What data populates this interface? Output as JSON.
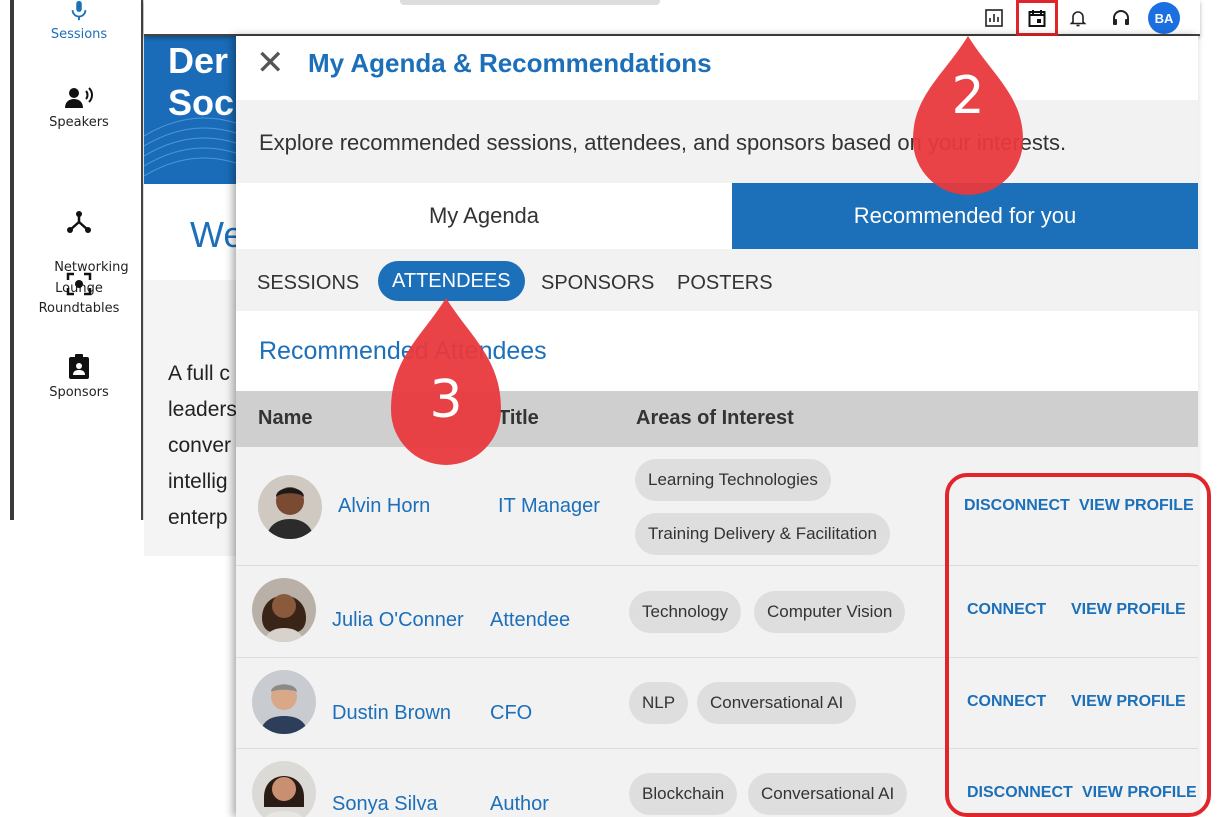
{
  "sidebar": {
    "items": [
      {
        "label": "Sessions",
        "icon": "microphone-icon",
        "active": true
      },
      {
        "label": "Speakers",
        "icon": "speaker-icon"
      },
      {
        "label": "Networking\nLounge",
        "icon": "network-icon"
      },
      {
        "label": "Roundtables",
        "icon": "roundtable-icon"
      },
      {
        "label": "Sponsors",
        "icon": "badge-icon"
      }
    ]
  },
  "topbar": {
    "icons": [
      "chart-icon",
      "calendar-icon",
      "bell-icon",
      "headset-icon"
    ],
    "avatar_initials": "BA"
  },
  "background_page": {
    "hero_title": "Der\nSoc",
    "welcome": "We",
    "paragraph": "A full c\nleaders\nconver\nintellig\nenterp"
  },
  "panel": {
    "title": "My Agenda & Recommendations",
    "description": "Explore recommended sessions, attendees, and sponsors based on your interests.",
    "tabs": {
      "my_agenda": "My Agenda",
      "recommended": "Recommended for you"
    },
    "subtabs": {
      "sessions": "SESSIONS",
      "attendees": "ATTENDEES",
      "sponsors": "SPONSORS",
      "posters": "POSTERS"
    },
    "section_title": "Recommended Attendees",
    "columns": {
      "name": "Name",
      "title": "Title",
      "interests": "Areas of Interest"
    },
    "rows": [
      {
        "name": "Alvin Horn",
        "title": "IT Manager",
        "interests": [
          "Learning Technologies",
          "Training Delivery & Facilitation"
        ],
        "primary_action": "DISCONNECT",
        "secondary_action": "VIEW PROFILE"
      },
      {
        "name": "Julia O'Conner",
        "title": "Attendee",
        "interests": [
          "Technology",
          "Computer Vision"
        ],
        "primary_action": "CONNECT",
        "secondary_action": "VIEW PROFILE"
      },
      {
        "name": "Dustin Brown",
        "title": "CFO",
        "interests": [
          "NLP",
          "Conversational AI"
        ],
        "primary_action": "CONNECT",
        "secondary_action": "VIEW PROFILE"
      },
      {
        "name": "Sonya Silva",
        "title": "Author",
        "interests": [
          "Blockchain",
          "Conversational AI"
        ],
        "primary_action": "DISCONNECT",
        "secondary_action": "VIEW PROFILE"
      }
    ]
  },
  "callouts": {
    "pin_2": "2",
    "pin_3": "3"
  },
  "colors": {
    "accent": "#1c6fb9",
    "callout_red": "#e8393d",
    "avatar_blue": "#1c6fe0"
  }
}
